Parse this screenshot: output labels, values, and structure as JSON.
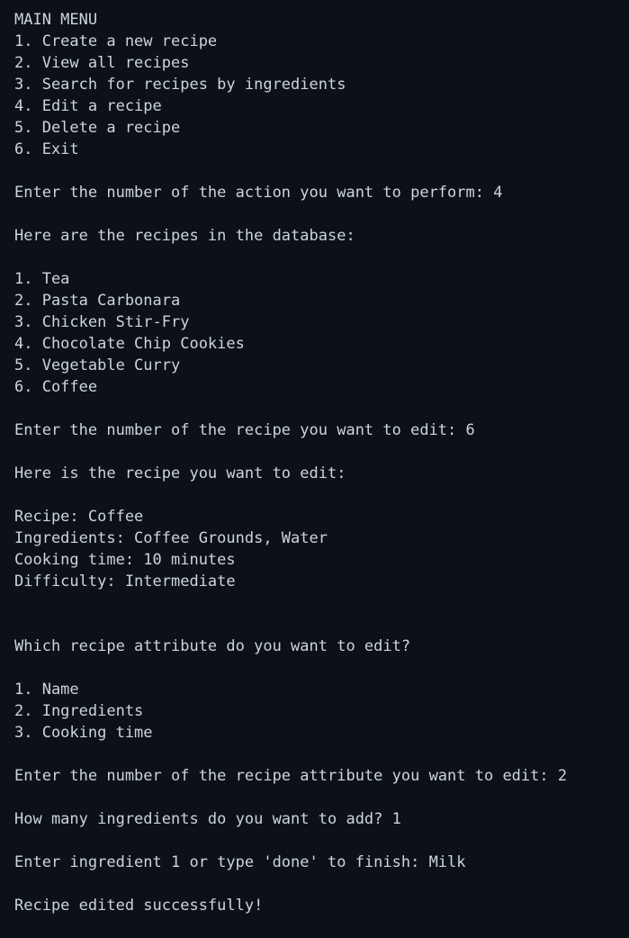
{
  "terminal": {
    "lines": [
      "MAIN MENU",
      "1. Create a new recipe",
      "2. View all recipes",
      "3. Search for recipes by ingredients",
      "4. Edit a recipe",
      "5. Delete a recipe",
      "6. Exit",
      "",
      "Enter the number of the action you want to perform: 4",
      "",
      "Here are the recipes in the database:",
      "",
      "1. Tea",
      "2. Pasta Carbonara",
      "3. Chicken Stir-Fry",
      "4. Chocolate Chip Cookies",
      "5. Vegetable Curry",
      "6. Coffee",
      "",
      "Enter the number of the recipe you want to edit: 6",
      "",
      "Here is the recipe you want to edit:",
      "",
      "Recipe: Coffee",
      "Ingredients: Coffee Grounds, Water",
      "Cooking time: 10 minutes",
      "Difficulty: Intermediate",
      "",
      "",
      "Which recipe attribute do you want to edit?",
      "",
      "1. Name",
      "2. Ingredients",
      "3. Cooking time",
      "",
      "Enter the number of the recipe attribute you want to edit: 2",
      "",
      "How many ingredients do you want to add? 1",
      "",
      "Enter ingredient 1 or type 'done' to finish: Milk",
      "",
      "Recipe edited successfully!"
    ]
  }
}
